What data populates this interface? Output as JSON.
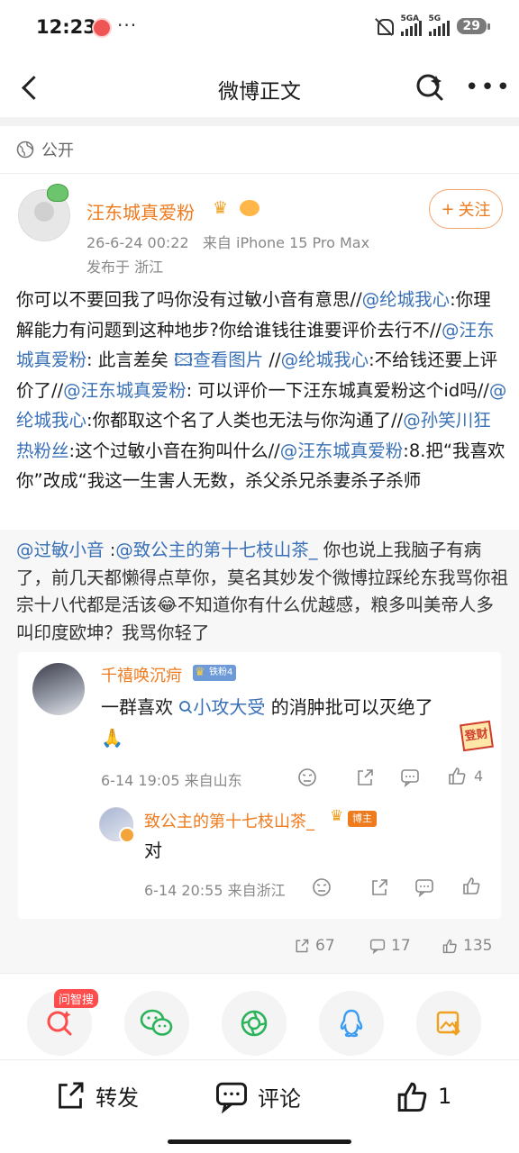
{
  "status_bar": {
    "time": "12:23",
    "dots": "···",
    "net1": "5GA",
    "net2": "5G",
    "battery": "29"
  },
  "nav": {
    "title": "微博正文"
  },
  "visibility": {
    "label": "公开"
  },
  "author": {
    "name": "汪东城真爱粉",
    "follow_label": "关注",
    "follow_plus": "+",
    "time": "26-6-24 00:22",
    "source": "来自 iPhone 15 Pro Max",
    "location": "发布于 浙江"
  },
  "post": {
    "s1": "你可以不要回我了吗你没有过敏小音有意思//",
    "m1": "@纶城我心",
    "s2": ":你理解能力有问题到这种地步?你给谁钱往谁要评价去行不//",
    "m2": "@汪东城真爱粉",
    "s3": ": 此言差矣 ",
    "pic_icon": "🖾",
    "pic_label": "查看图片",
    "s4": "  //",
    "m3": "@纶城我心",
    "s5": ":不给钱还要上评价了//",
    "m4": "@汪东城真爱粉",
    "s6": ": 可以评价一下汪东城真爱粉这个id吗//",
    "m5": "@纶城我心",
    "s7": ":你都取这个名了人类也无法与你沟通了//",
    "m6": "@孙笑川狂热粉丝",
    "s8": ":这个过敏小音在狗叫什么//",
    "m7": "@汪东城真爱粉",
    "s9": ":8.把“我喜欢你”改成“我这一生害人无数，杀父杀兄杀妻杀子杀师"
  },
  "quoted": {
    "m1": "@过敏小音",
    "s1": " :",
    "m2": "@致公主的第十七枝山茶_",
    "s2": " 你也说上我脑子有病了，前几天都懒得点草你，莫名其妙发个微博拉踩纶东我骂你祖宗十八代都是活该",
    "emoji": "😂",
    "s3": "不知道你有什么优越感，粮多叫美帝人多叫印度欧坤？我骂你轻了"
  },
  "comment": {
    "name": "千禧唤沉疴",
    "badge": "铁粉4",
    "pre": "一群喜欢 ",
    "topic": "小攻大受",
    "post": " 的消肿批可以灭绝了",
    "emoji": "🙏",
    "stamp": "登财",
    "time": "6-14 19:05",
    "source": "来自山东",
    "likes": "4"
  },
  "reply": {
    "name": "致公主的第十七枝山茶_",
    "badge": "博主",
    "text": "对",
    "time": "6-14 20:55",
    "source": "来自浙江"
  },
  "stats": {
    "reposts": "67",
    "comments": "17",
    "likes": "135"
  },
  "share": {
    "ask_tag": "问智搜"
  },
  "toolbar": {
    "repost": "转发",
    "comment": "评论",
    "like": "1"
  },
  "colors": {
    "accent": "#ee7b1e",
    "link": "#3970b6",
    "wechat": "#2bb35a",
    "qq": "#3b9cf0"
  },
  "icons": [
    "search-ai-icon",
    "wechat-icon",
    "moments-icon",
    "qq-icon",
    "save-image-icon",
    "repost-icon",
    "comment-icon",
    "like-icon",
    "dislike-icon",
    "globe-icon"
  ]
}
